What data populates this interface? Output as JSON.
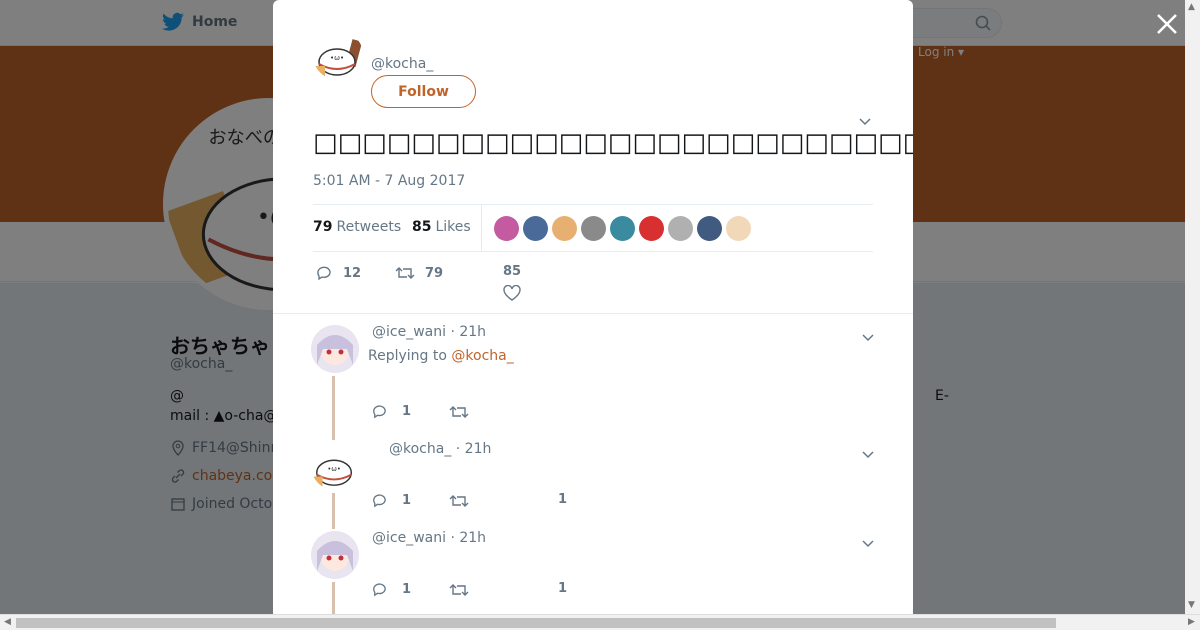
{
  "nav": {
    "home_label": "Home",
    "login_label": "Log in ▾"
  },
  "profile": {
    "name": "おちゃちゃ",
    "handle": "@kocha_",
    "bio_line1": "@",
    "bio_line1_right": "E-",
    "bio_line2": "mail : ▲o-cha@",
    "location": "FF14@Shinr",
    "url": "chabeya.co",
    "joined": "Joined Octo"
  },
  "tweet": {
    "handle": "@kocha_",
    "follow_label": "Follow",
    "text": "□□□□□□□□□□□□□□□□□□□□□□□□□□□□□□□□□□□□□□□□□□□□□□□□□□□□□□□□□□□□□□□□□□□□□□□□□(□ω□",
    "time": "5:01 AM - 7 Aug 2017",
    "retweets_count": "79",
    "retweets_label": "Retweets",
    "likes_count": "85",
    "likes_label": "Likes",
    "reply_count": "12",
    "retweet_count": "79",
    "like_count": "85"
  },
  "likers": [
    "#c45aa0",
    "#4a6a9a",
    "#e8b070",
    "#8a8a8a",
    "#3a8aa0",
    "#d83030",
    "#b0b0b0",
    "#405a80",
    "#f0d8b8"
  ],
  "replies": [
    {
      "handle": "@ice_wani · 21h",
      "replying_prefix": "Replying to ",
      "replying_to": "@kocha_",
      "reply_count": "1",
      "like_count": ""
    },
    {
      "handle": "@kocha_ · 21h",
      "reply_count": "1",
      "like_count": "1"
    },
    {
      "handle": "@ice_wani · 21h",
      "reply_count": "1",
      "like_count": "1"
    }
  ],
  "colors": {
    "accent": "#c0642a",
    "banner": "#c0642a",
    "text_muted": "#657786"
  }
}
